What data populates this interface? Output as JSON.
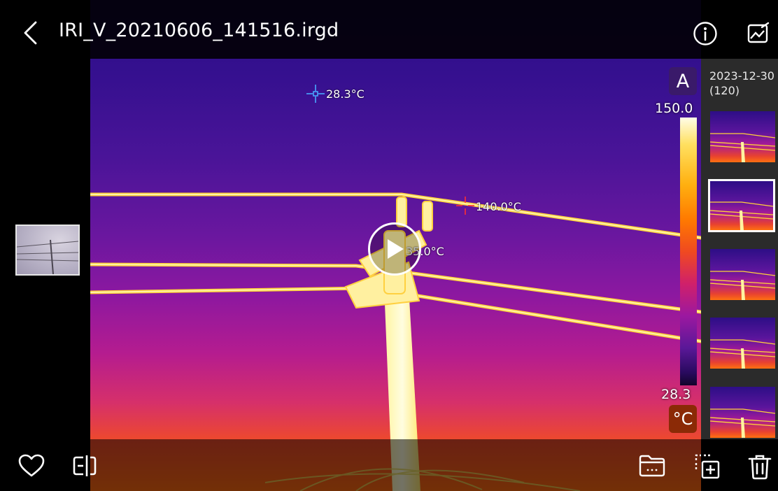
{
  "file": {
    "name": "IRI_V_20210606_141516.irgd"
  },
  "icons": {
    "back": "chevron-left-icon",
    "info": "info-icon",
    "edit": "image-edit-icon",
    "favorite": "heart-icon",
    "compare": "compare-icon",
    "folder": "folder-icon",
    "add_to": "add-to-album-icon",
    "delete": "trash-icon",
    "play": "play-icon"
  },
  "gallery": {
    "date": "2023-12-30",
    "count": "(120)",
    "selected_index": 1
  },
  "scale": {
    "mode": "A",
    "max": "150.0",
    "min": "28.3",
    "unit": "°C"
  },
  "markers": [
    {
      "label": "28.3°C",
      "kind": "min",
      "color": "#4aa8ff"
    },
    {
      "label": "140.0°C",
      "kind": "max",
      "color": "#ff3030"
    },
    {
      "label": "35.0°C",
      "kind": "center",
      "color": "#ffffff"
    }
  ],
  "colors": {
    "panel": "#2b2b2b",
    "accent_badge": "#8b2a06",
    "mode_badge": "#3a1a6a"
  }
}
